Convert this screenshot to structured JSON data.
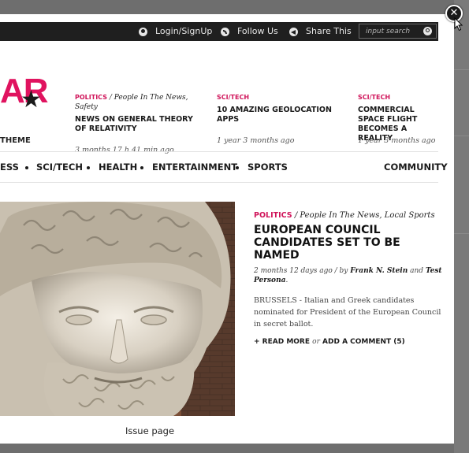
{
  "topbar": {
    "login_label": "Login/SignUp",
    "follow_label": "Follow Us",
    "share_label": "Share This",
    "search_placeholder": "input search",
    "icons": [
      "user-icon",
      "rss-icon",
      "share-icon",
      "search-icon"
    ]
  },
  "close_icon": "close-icon",
  "logo": {
    "text": "AR",
    "star": "★",
    "subtitle": "THEME",
    "color": "#e0135f"
  },
  "news": [
    {
      "category": "POLITICS",
      "tags": "People In The News, Safety",
      "title": "NEWS ON GENERAL THEORY OF RELATIVITY",
      "time": "3 months 17 h 41 min ago"
    },
    {
      "category": "SCI/TECH",
      "tags": "",
      "title": "10 AMAZING GEOLOCATION APPS",
      "time": "1 year 3 months ago"
    },
    {
      "category": "SCI/TECH",
      "tags": "",
      "title": "COMMERCIAL SPACE FLIGHT BECOMES A REALITY",
      "time": "1 year 3 months ago"
    }
  ],
  "nav": {
    "items": [
      "ESS",
      "SCI/TECH",
      "HEALTH",
      "ENTERTAINMENT",
      "SPORTS"
    ],
    "community": "COMMUNITY"
  },
  "featured": {
    "category": "POLITICS",
    "tags": "People In The News, Local Sports",
    "headline": "EUROPEAN COUNCIL CANDIDATES SET TO BE NAMED",
    "time": "2 months 12 days ago",
    "by_label": "by",
    "author1": "Frank N. Stein",
    "and_label": "and",
    "author2": "Test Persona",
    "excerpt": "BRUSSELS - Italian and Greek candidates nominated for President of the European Council in secret ballot.",
    "read_more": "+ READ MORE",
    "or_label": "or",
    "add_comment": "ADD A COMMENT (5)",
    "image_caption": "Issue page"
  },
  "colors": {
    "accent": "#d0145a",
    "topbar": "#1f1f1f",
    "overlay": "#6e6e6e"
  }
}
